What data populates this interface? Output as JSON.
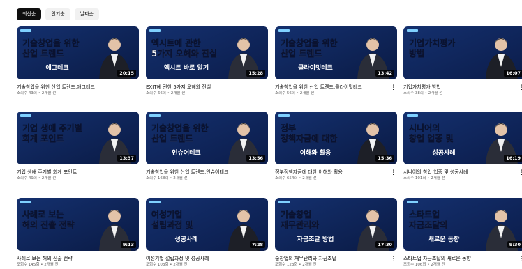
{
  "filters": [
    {
      "label": "최신순",
      "active": true
    },
    {
      "label": "인기순",
      "active": false
    },
    {
      "label": "날짜순",
      "active": false
    }
  ],
  "videos": [
    {
      "lines": [
        "기술창업을 위한",
        "산업 트렌드"
      ],
      "tag": "애그테크",
      "duration": "20:15",
      "title": "기술창업을 위한 산업 트렌드,애그테크",
      "meta": "조회수 43회 • 2개월 전",
      "bg": "#0a1a44",
      "accent": "#3ab8ff"
    },
    {
      "lines": [
        "엑시트에 관한",
        "5가지 오해와 진실"
      ],
      "tag": "엑시트 바로 알기",
      "duration": "15:28",
      "title": "EXIT에 관한 5가지 오해와 진실",
      "meta": "조회수 66회 • 2개월 전",
      "bg": "#0b1c4a",
      "accent": "#3ab8ff"
    },
    {
      "lines": [
        "기술창업을 위한",
        "산업 트렌드"
      ],
      "tag": "클라이밋테크",
      "duration": "13:42",
      "title": "기술창업을 위한 산업 트렌드,클라이밋테크",
      "meta": "조회수 56회 • 2개월 전",
      "bg": "#0a1a44",
      "accent": "#3ab8ff"
    },
    {
      "lines": [
        "기업가치평가",
        "방법"
      ],
      "tag": "",
      "duration": "16:07",
      "title": "기업가치평가 방법",
      "meta": "조회수 38회 • 2개월 전",
      "bg": "#0b1c4a",
      "accent": "#3ab8ff"
    },
    {
      "lines": [
        "기업 생애 주기별",
        "회계 포인트"
      ],
      "tag": "",
      "duration": "13:37",
      "title": "기업 생애 주기별 회계 포인트",
      "meta": "조회수 49회 • 2개월 전",
      "bg": "#0a1a44",
      "accent": "#3ab8ff"
    },
    {
      "lines": [
        "기술창업을 위한",
        "산업 트렌드"
      ],
      "tag": "인슈어테크",
      "duration": "13:56",
      "title": "기술창업을 위한 산업 트렌드,인슈어테크",
      "meta": "조회수 168회 • 2개월 전",
      "bg": "#0b1c4a",
      "accent": "#3ab8ff"
    },
    {
      "lines": [
        "정부",
        "정책자금에 대한"
      ],
      "tag": "이해와 활용",
      "duration": "15:36",
      "title": "정부정책자금에 대한 이해와 활용",
      "meta": "조회수 654회 • 2개월 전",
      "bg": "#0a1a44",
      "accent": "#3ab8ff"
    },
    {
      "lines": [
        "시니어의",
        "창업 업종 및"
      ],
      "tag": "성공사례",
      "duration": "16:19",
      "title": "시니어의 창업 업종 및 성공사례",
      "meta": "조회수 101회 • 2개월 전",
      "bg": "#0b1c4a",
      "accent": "#3ab8ff"
    },
    {
      "lines": [
        "사례로 보는",
        "해외 진출 전략"
      ],
      "tag": "",
      "duration": "9:13",
      "title": "사례로 보는 해외 진출 전략",
      "meta": "조회수 145회 • 2개월 전",
      "bg": "#0a1a44",
      "accent": "#3ab8ff"
    },
    {
      "lines": [
        "여성기업",
        "설립과정 및"
      ],
      "tag": "성공사례",
      "duration": "7:28",
      "title": "여성기업 설립과정 및 성공사례",
      "meta": "조회수 103회 • 2개월 전",
      "bg": "#0b1c4a",
      "accent": "#3ab8ff"
    },
    {
      "lines": [
        "기술창업",
        "재무관리와"
      ],
      "tag": "자금조달 방법",
      "duration": "17:30",
      "title": "술창업의 재무관리와 자금조달",
      "meta": "조회수 123회 • 2개월 전",
      "bg": "#0a1a44",
      "accent": "#3ab8ff"
    },
    {
      "lines": [
        "스타트업",
        "자금조달의"
      ],
      "tag": "새로운 동향",
      "duration": "9:30",
      "title": "스타트업 자금조달의 새로운 동향",
      "meta": "조회수 106회 • 2개월 전",
      "bg": "#0b1c4a",
      "accent": "#3ab8ff"
    }
  ],
  "more_glyph": "⋮"
}
